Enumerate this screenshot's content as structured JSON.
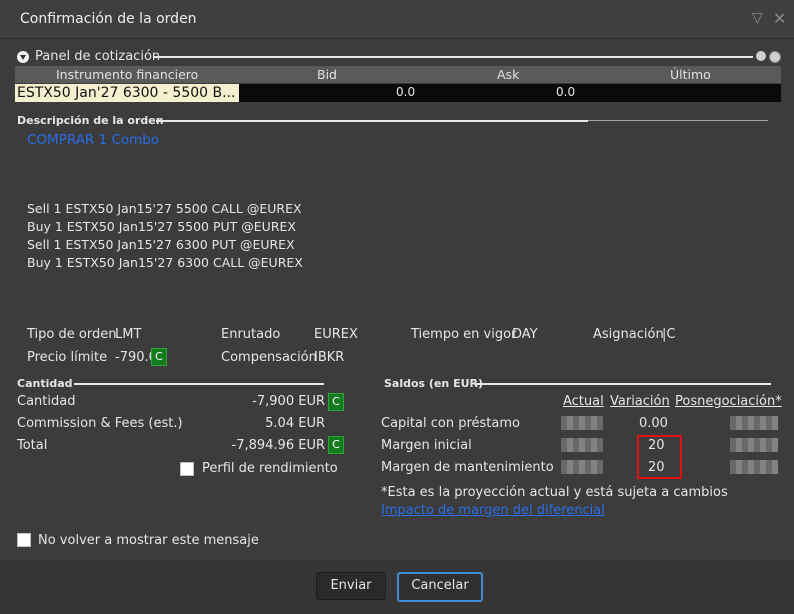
{
  "window": {
    "title": "Confirmación de la orden"
  },
  "quote_panel": {
    "label": "Panel de cotización",
    "headers": [
      "Instrumento financiero",
      "Bid",
      "Ask",
      "Último"
    ],
    "instrument": "ESTX50 Jan'27 6300 - 5500 B...",
    "bid": "0.0",
    "ask": "0.0",
    "last": ""
  },
  "order_description": {
    "label": "Descripción de la orden",
    "action": "COMPRAR 1 Combo",
    "legs": [
      "Sell 1 ESTX50 Jan15'27 5500 CALL @EUREX",
      "Buy 1 ESTX50 Jan15'27 5500 PUT @EUREX",
      "Sell 1 ESTX50 Jan15'27 6300 PUT @EUREX",
      "Buy 1 ESTX50 Jan15'27 6300 CALL @EUREX"
    ]
  },
  "order_params": {
    "order_type_label": "Tipo de orden",
    "order_type": "LMT",
    "routing_label": "Enrutado",
    "routing": "EUREX",
    "tif_label": "Tiempo en vigor",
    "tif": "DAY",
    "allocation_label": "Asignación",
    "allocation": "|C",
    "limit_price_label": "Precio límite",
    "limit_price": "-790.0",
    "clearing_label": "Compensación",
    "clearing": "IBKR"
  },
  "quantity": {
    "label": "Cantidad",
    "rows": [
      {
        "label": "Cantidad",
        "value": "-7,900 EUR"
      },
      {
        "label": "Commission & Fees (est.)",
        "value": "5.04 EUR"
      },
      {
        "label": "Total",
        "value": "-7,894.96 EUR"
      }
    ],
    "profile_label": "Perfil de rendimiento"
  },
  "balances": {
    "label": "Saldos (en EUR)",
    "columns": [
      "Actual",
      "Variación",
      "Posnegociación*"
    ],
    "rows": [
      {
        "label": "Capital con préstamo",
        "variation": "0.00"
      },
      {
        "label": "Margen inicial",
        "variation": "20"
      },
      {
        "label": "Margen de mantenimiento",
        "variation": "20"
      }
    ],
    "note": "*Esta es la proyección actual y está sujeta a cambios",
    "link": "Impacto de margen del diferencial"
  },
  "c_badge": "C",
  "dont_show_label": "No volver a mostrar este mensaje",
  "buttons": {
    "send": "Enviar",
    "cancel": "Cancelar"
  },
  "colors": {
    "accent": "#2a6de6",
    "highlight": "#e01010",
    "badge": "#157a1e"
  }
}
